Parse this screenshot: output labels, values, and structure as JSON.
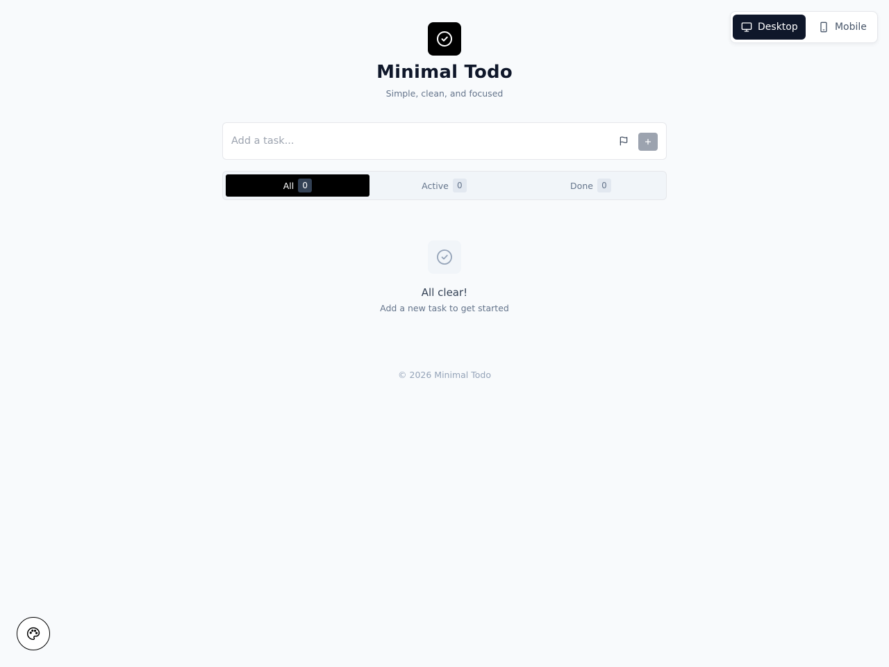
{
  "view_toggle": {
    "desktop_label": "Desktop",
    "mobile_label": "Mobile",
    "selected": "Desktop"
  },
  "header": {
    "title": "Minimal Todo",
    "subtitle": "Simple, clean, and focused",
    "logo_icon": "check-circle-icon"
  },
  "task_input": {
    "placeholder": "Add a task...",
    "value": "",
    "priority_icon": "flag-icon",
    "add_icon": "plus-icon"
  },
  "filters": {
    "selected": "All",
    "tabs": [
      {
        "label": "All",
        "count": "0"
      },
      {
        "label": "Active",
        "count": "0"
      },
      {
        "label": "Done",
        "count": "0"
      }
    ]
  },
  "empty_state": {
    "icon": "check-circle-icon",
    "title": "All clear!",
    "subtitle": "Add a new task to get started"
  },
  "footer": {
    "text": "© 2026 Minimal Todo"
  },
  "theme_button": {
    "icon": "palette-icon"
  },
  "colors": {
    "background": "#f8fafc",
    "primary": "#0f172a",
    "accent": "#000000",
    "muted_text": "#64748b",
    "disabled_button": "#9ca3af"
  }
}
